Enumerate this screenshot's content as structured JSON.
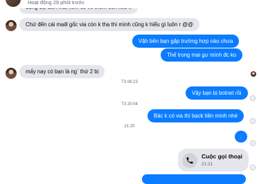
{
  "header": {
    "status": "Hoạt động 29 phút trước"
  },
  "messages": {
    "m1": "dùng dọi đến mai xem có về thêm còn kéo k",
    "m2": "Chứ đến cái maill gốc via còn k tha thì mình cũng k hiểu gì luôn r @@",
    "m3": "Vậh bên bạn gặp trường hợp nào chưa",
    "m4": "Thế trong mai gư mình đc ko",
    "m5": "mấy nay có bạn là ng` thứ 2 bị",
    "ts1": "T3 06:23",
    "m6": "Vậy bạn bị botnet rồi",
    "ts2": "T3 20:04",
    "m7": "Bác k có via thì back tiền mình nhé",
    "ts3": "21:20",
    "m8": ".",
    "call_title": "Cuộc gọi thoại",
    "call_time": "21:21"
  },
  "icons": {
    "phone": "phone-icon",
    "seen": "seen-check-icon"
  },
  "colors": {
    "outgoing": "#0a7cff",
    "incoming": "#e4e6eb"
  }
}
